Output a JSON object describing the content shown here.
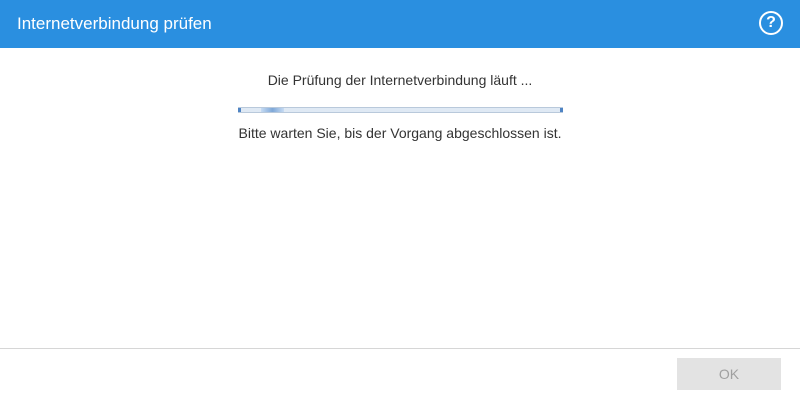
{
  "dialog": {
    "title": "Internetverbindung prüfen",
    "help_label": "?"
  },
  "content": {
    "status_text": "Die Prüfung der Internetverbindung läuft ...",
    "wait_text": "Bitte warten Sie, bis der Vorgang abgeschlossen ist."
  },
  "progress": {
    "indeterminate": true,
    "indicator_start": 0.07,
    "indicator_end": 0.14
  },
  "footer": {
    "ok_label": "OK",
    "ok_disabled": true
  },
  "colors": {
    "titlebar": "#2a8fe0",
    "ok_disabled_bg": "#e3e3e3",
    "ok_disabled_text": "#a0a0a0"
  }
}
